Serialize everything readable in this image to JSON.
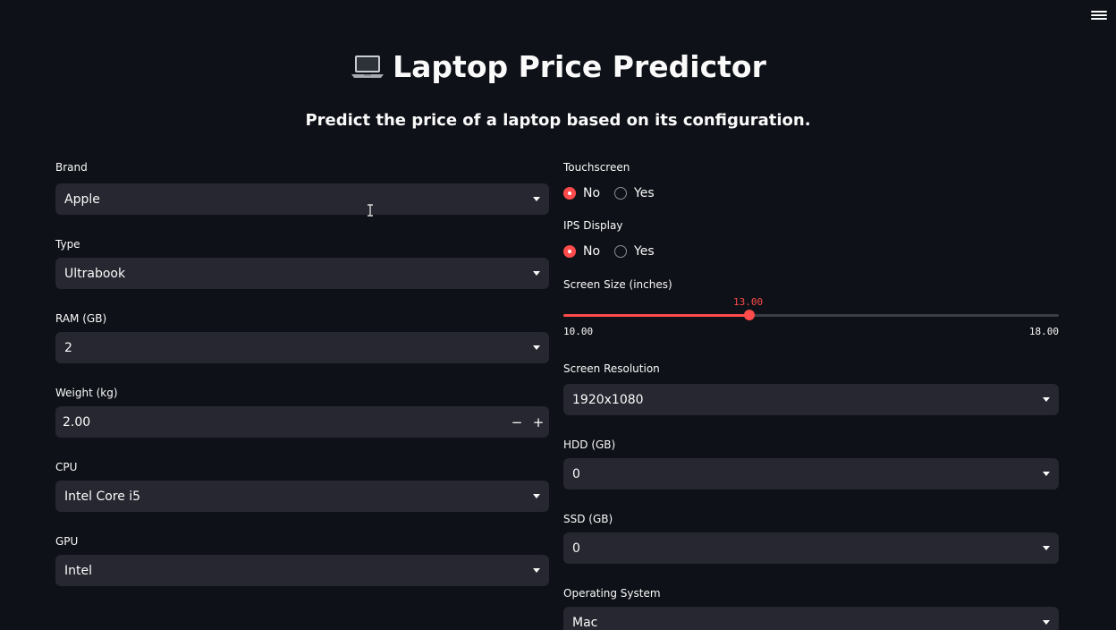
{
  "header": {
    "title": "Laptop Price Predictor",
    "subtitle": "Predict the price of a laptop based on its configuration."
  },
  "icons": {
    "title_icon": "laptop-icon",
    "menu": "hamburger-menu-icon",
    "dropdown": "chevron-down-icon"
  },
  "colors": {
    "background": "#0e1117",
    "input_bg": "#262730",
    "accent": "#ff4b4b"
  },
  "left": {
    "brand": {
      "label": "Brand",
      "value": "Apple"
    },
    "type": {
      "label": "Type",
      "value": "Ultrabook"
    },
    "ram": {
      "label": "RAM (GB)",
      "value": "2"
    },
    "weight": {
      "label": "Weight (kg)",
      "value": "2.00",
      "minus": "−",
      "plus": "+"
    },
    "cpu": {
      "label": "CPU",
      "value": "Intel Core i5"
    },
    "gpu": {
      "label": "GPU",
      "value": "Intel"
    }
  },
  "right": {
    "touchscreen": {
      "label": "Touchscreen",
      "options": [
        "No",
        "Yes"
      ],
      "selected": "No"
    },
    "ips": {
      "label": "IPS Display",
      "options": [
        "No",
        "Yes"
      ],
      "selected": "No"
    },
    "screen_size": {
      "label": "Screen Size (inches)",
      "value": 13.0,
      "value_text": "13.00",
      "min": 10.0,
      "max": 18.0,
      "min_text": "10.00",
      "max_text": "18.00"
    },
    "resolution": {
      "label": "Screen Resolution",
      "value": "1920x1080"
    },
    "hdd": {
      "label": "HDD (GB)",
      "value": "0"
    },
    "ssd": {
      "label": "SSD (GB)",
      "value": "0"
    },
    "os": {
      "label": "Operating System",
      "value": "Mac"
    }
  }
}
